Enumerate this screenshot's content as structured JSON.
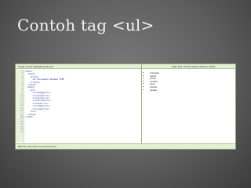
{
  "slide": {
    "title": "Contoh tag <ul>"
  },
  "editor": {
    "header": "Toggle syntax highlighting (IE too)",
    "footer": "Edit the code above to see the result.",
    "line_numbers": [
      "1",
      "2",
      "3",
      "4",
      "5",
      "6",
      "7",
      "8",
      "9",
      "10",
      "11",
      "12",
      "13",
      "14",
      "15",
      "16",
      "17",
      "18",
      "19",
      "20",
      "21",
      "22",
      "23",
      "24"
    ],
    "code_lines": [
      "<html>",
      "  <head>",
      "    <title>",
      "      Ini Merupakan Halaman HTML",
      "    </title>",
      "  </head>",
      "  <body>",
      "    <ul>",
      "      <li>mangga</li>",
      "      <li>salak</li>",
      "      <li>jeruk</li>",
      "      <li>durian</li>",
      "      <li>apel</li>",
      "      <li>jambu</li>",
      "      <li>nanas</li>",
      "    </ul>",
      "  </body>",
      "</html>",
      "",
      "",
      "",
      "",
      "",
      ""
    ]
  },
  "preview": {
    "header": "Page Title: Ini Merupakan Halaman HTML",
    "items": [
      "mangga",
      "salak",
      "jeruk",
      "durian",
      "apel",
      "jambu",
      "nanas"
    ]
  }
}
